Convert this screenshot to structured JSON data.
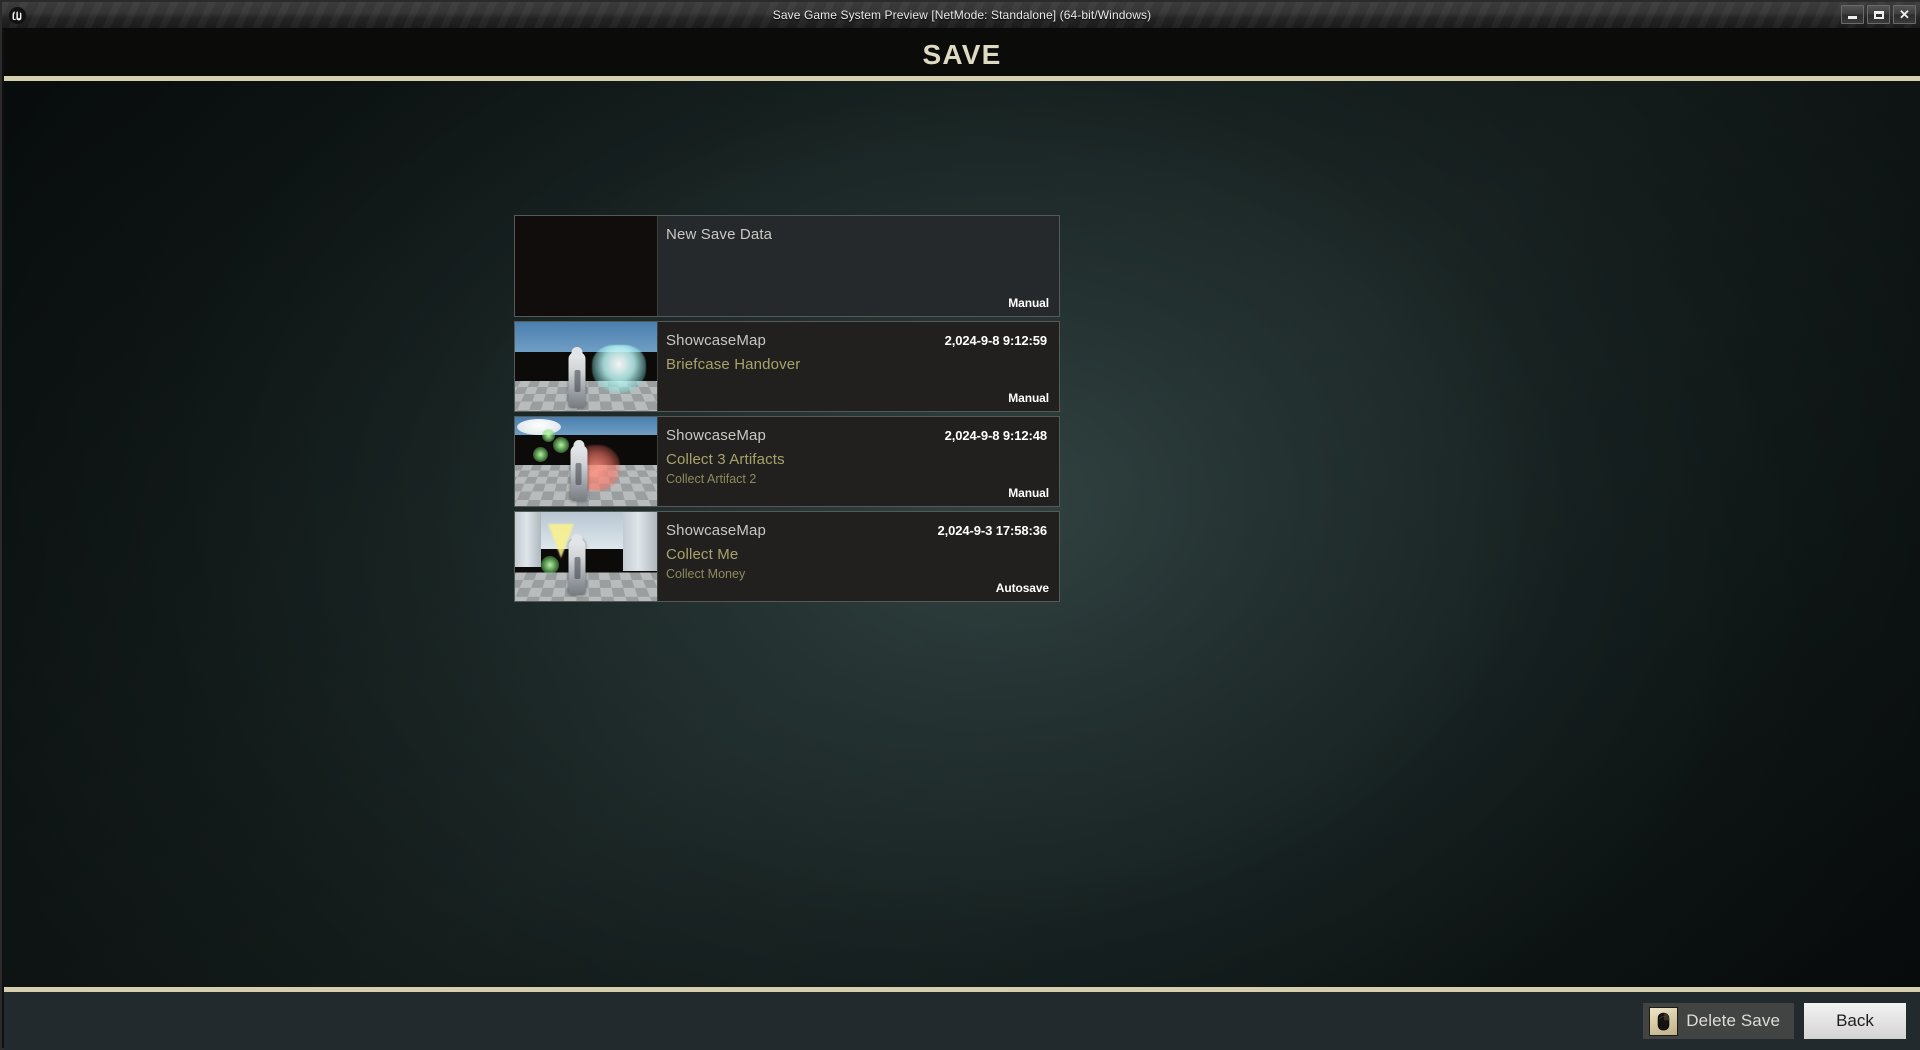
{
  "window": {
    "title": "Save Game System Preview [NetMode: Standalone]  (64-bit/Windows)",
    "logo_icon": "unreal-engine-logo",
    "controls": {
      "minimize_icon": "minimize-icon",
      "maximize_icon": "maximize-icon",
      "close_icon": "close-icon",
      "close_glyph": "✕"
    }
  },
  "header": {
    "title": "SAVE",
    "rule_color": "#d6cfae"
  },
  "theme": {
    "accent": "#d6cfae",
    "quest_text": "#a8a36a",
    "objective_text": "#8e8a5c",
    "map_text": "#c9c8c3",
    "background": "#16201f"
  },
  "slots": [
    {
      "map": "New Save Data",
      "timestamp": "",
      "quest": "",
      "objective": "",
      "type": "Manual",
      "empty": true,
      "thumbnail": "empty-thumbnail"
    },
    {
      "map": "ShowcaseMap",
      "timestamp": "2,024-9-8 9:12:59",
      "quest": "Briefcase Handover",
      "objective": "",
      "type": "Manual",
      "empty": false,
      "thumbnail": "showcasemap-briefcase-thumbnail"
    },
    {
      "map": "ShowcaseMap",
      "timestamp": "2,024-9-8 9:12:48",
      "quest": "Collect 3 Artifacts",
      "objective": "Collect Artifact 2",
      "type": "Manual",
      "empty": false,
      "thumbnail": "showcasemap-artifacts-thumbnail"
    },
    {
      "map": "ShowcaseMap",
      "timestamp": "2,024-9-3 17:58:36",
      "quest": "Collect Me",
      "objective": "Collect Money",
      "type": "Autosave",
      "empty": false,
      "thumbnail": "showcasemap-collectme-thumbnail"
    }
  ],
  "footer": {
    "delete_save_label": "Delete Save",
    "delete_save_icon": "mouse-right-click-icon",
    "back_label": "Back"
  }
}
